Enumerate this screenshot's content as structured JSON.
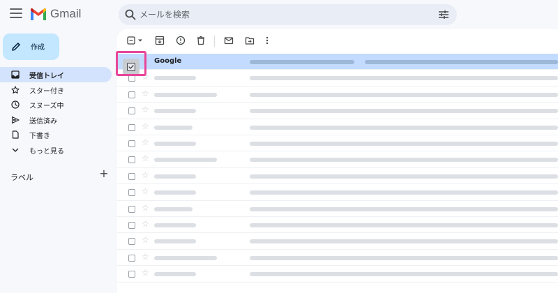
{
  "app": {
    "name": "Gmail",
    "accent_color": "#c2e7ff",
    "highlight_color": "#e8479a"
  },
  "search": {
    "placeholder": "メールを検索"
  },
  "compose": {
    "label": "作成"
  },
  "sidebar": {
    "items": [
      {
        "label": "受信トレイ",
        "icon": "inbox-icon",
        "active": true
      },
      {
        "label": "スター付き",
        "icon": "star-icon",
        "active": false
      },
      {
        "label": "スヌーズ中",
        "icon": "clock-icon",
        "active": false
      },
      {
        "label": "送信済み",
        "icon": "send-icon",
        "active": false
      },
      {
        "label": "下書き",
        "icon": "draft-icon",
        "active": false
      },
      {
        "label": "もっと見る",
        "icon": "chevron-down-icon",
        "active": false
      }
    ],
    "labels_heading": "ラベル",
    "labels_add": "+"
  },
  "toolbar": {
    "icons": [
      "select-all-checkbox-icon",
      "archive-icon",
      "report-spam-icon",
      "delete-icon",
      "mark-unread-icon",
      "move-to-icon",
      "more-vert-icon"
    ]
  },
  "email_list": {
    "first_row_sender": "Google"
  }
}
